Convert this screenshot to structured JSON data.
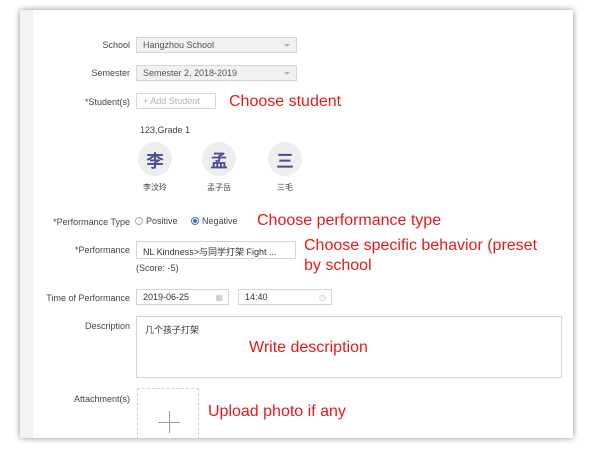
{
  "form": {
    "school": {
      "label": "School",
      "value": "Hangzhou School"
    },
    "semester": {
      "label": "Semester",
      "value": "Semester 2, 2018-2019"
    },
    "students": {
      "label": "*Student(s)",
      "add_button": "+ Add Student",
      "class_text": "123,Grade 1",
      "list": [
        {
          "avatar": "李",
          "name": "李汶玲"
        },
        {
          "avatar": "孟",
          "name": "孟子岳"
        },
        {
          "avatar": "三",
          "name": "三毛"
        }
      ]
    },
    "performance_type": {
      "label": "*Performance Type",
      "options": [
        "Positive",
        "Negative"
      ],
      "selected": "Negative"
    },
    "performance": {
      "label": "*Performance",
      "value": "NL Kindness>与同学打架 Fight ...",
      "score": "(Score: -5)"
    },
    "time": {
      "label": "Time of Performance",
      "date": "2019-06-25",
      "time": "14:40"
    },
    "description": {
      "label": "Description",
      "value": "几个孩子打架"
    },
    "attachments": {
      "label": "Attachment(s)"
    }
  },
  "annotations": {
    "choose_student": "Choose student",
    "choose_type": "Choose performance type",
    "choose_behavior_1": "Choose specific behavior (preset",
    "choose_behavior_2": "by school",
    "write_description": "Write description",
    "upload_photo": "Upload photo if any"
  },
  "colors": {
    "annotation": "#e41a1a",
    "radio_accent": "#3d6fd6",
    "avatar_text": "#4a4a96"
  }
}
